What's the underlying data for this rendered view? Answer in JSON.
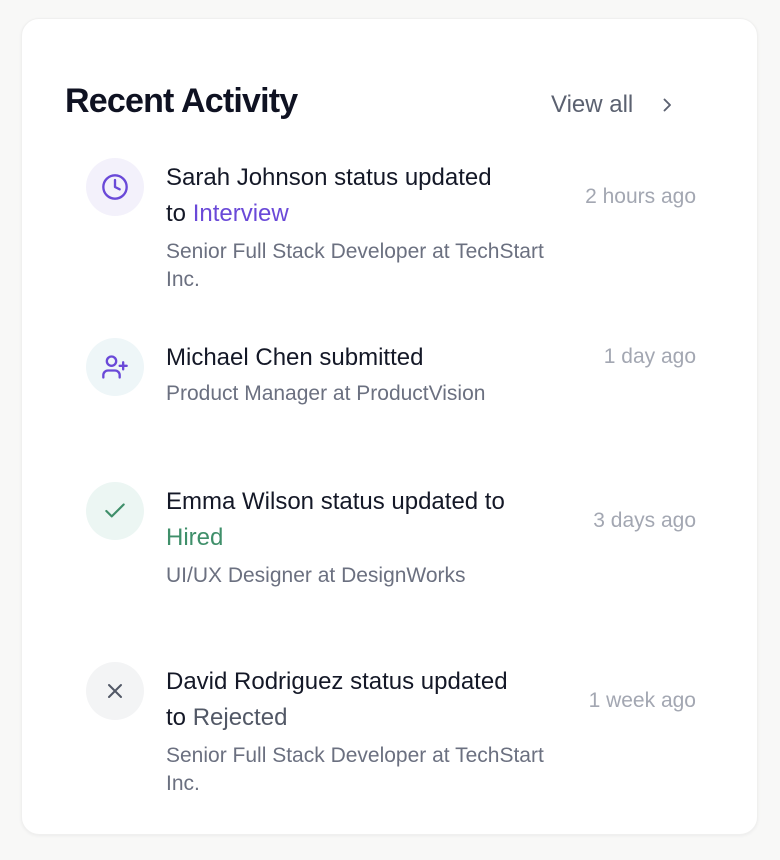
{
  "header": {
    "title": "Recent Activity",
    "view_all_label": "View all"
  },
  "activities": [
    {
      "icon": "clock-icon",
      "icon_color": "#6a49d8",
      "icon_bg": "#f3f1fb",
      "title_prefix": "Sarah Johnson status updated",
      "title_connector": "to",
      "status": "Interview",
      "status_color": "#6a49d8",
      "subtitle": "Senior Full Stack Developer at TechStart Inc.",
      "time": "2 hours ago"
    },
    {
      "icon": "user-plus-icon",
      "icon_color": "#6a49d8",
      "icon_bg": "#eef6f8",
      "title_prefix": "Michael Chen submitted",
      "subtitle": "Product Manager at ProductVision",
      "time": "1 day ago"
    },
    {
      "icon": "check-icon",
      "icon_color": "#3f8f6a",
      "icon_bg": "#ecf6f3",
      "title_prefix": "Emma Wilson status updated to",
      "status": "Hired",
      "status_color": "#3f8f6a",
      "subtitle": "UI/UX Designer at DesignWorks",
      "time": "3 days ago"
    },
    {
      "icon": "x-icon",
      "icon_color": "#525866",
      "icon_bg": "#f3f4f5",
      "title_prefix": "David Rodriguez status updated",
      "title_connector": "to",
      "status": "Rejected",
      "status_color": "#525866",
      "subtitle": "Senior Full Stack Developer at TechStart Inc.",
      "time": "1 week ago"
    }
  ]
}
